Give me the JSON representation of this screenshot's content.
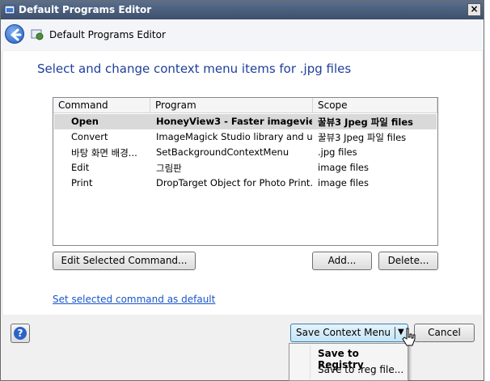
{
  "window": {
    "title": "Default Programs Editor",
    "close_glyph": "×"
  },
  "nav": {
    "title": "Default Programs Editor"
  },
  "heading": "Select and change context menu items for .jpg files",
  "table": {
    "columns": [
      "Command",
      "Program",
      "Scope"
    ],
    "rows": [
      {
        "command": "Open",
        "program": "HoneyView3 - Faster imagevie...",
        "scope": "꿀뷰3 Jpeg 파일 files",
        "selected": true
      },
      {
        "command": "Convert",
        "program": "ImageMagick Studio library and u...",
        "scope": "꿀뷰3 Jpeg 파일 files",
        "selected": false
      },
      {
        "command": "바탕 화면 배경...",
        "program": "SetBackgroundContextMenu",
        "scope": ".jpg files",
        "selected": false
      },
      {
        "command": "Edit",
        "program": "그림판",
        "scope": "image files",
        "selected": false
      },
      {
        "command": "Print",
        "program": "DropTarget Object for Photo Print...",
        "scope": "image files",
        "selected": false
      }
    ]
  },
  "buttons": {
    "edit_selected": "Edit Selected Command...",
    "add": "Add...",
    "delete": "Delete...",
    "save_context_menu": "Save Context Menu",
    "cancel": "Cancel",
    "help": "?"
  },
  "link": "Set selected command as default",
  "dropdown": {
    "items": [
      "Save to Registry",
      "Save to .reg file..."
    ]
  },
  "colors": {
    "heading": "#1e3e9b",
    "link": "#1a55c9",
    "titlebar": "#3d4f6b",
    "selected_row": "#d9d9d9"
  }
}
